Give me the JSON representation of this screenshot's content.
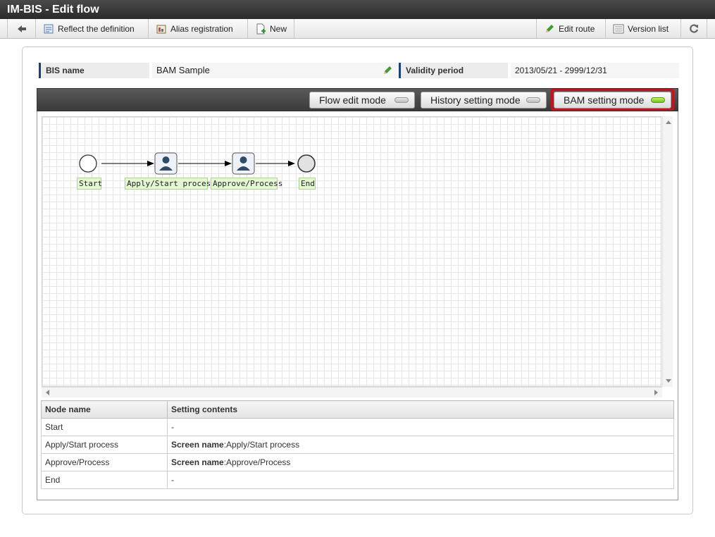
{
  "window": {
    "title": "IM-BIS - Edit flow"
  },
  "toolbar": {
    "back_icon": "back-arrow-icon",
    "reflect_label": "Reflect the definition",
    "alias_label": "Alias registration",
    "new_label": "New",
    "edit_route_label": "Edit route",
    "version_list_label": "Version list",
    "refresh_icon": "refresh-icon"
  },
  "info": {
    "bis_name_label": "BIS name",
    "bis_name_value": "BAM Sample",
    "validity_label": "Validity period",
    "validity_value": "2013/05/21  -  2999/12/31"
  },
  "modes": {
    "flow_edit": {
      "label": "Flow edit mode",
      "active": false
    },
    "history_setting": {
      "label": "History setting mode",
      "active": false
    },
    "bam_setting": {
      "label": "BAM setting mode",
      "active": true
    }
  },
  "flow": {
    "nodes": [
      {
        "label": "Start",
        "type": "start"
      },
      {
        "label": "Apply/Start process",
        "type": "user-task"
      },
      {
        "label": "Approve/Process",
        "type": "user-task"
      },
      {
        "label": "End",
        "type": "end"
      }
    ]
  },
  "settings_table": {
    "headers": [
      "Node name",
      "Setting contents"
    ],
    "rows": [
      {
        "node": "Start",
        "key": "",
        "value": "-"
      },
      {
        "node": "Apply/Start process",
        "key": "Screen name",
        "value": ":Apply/Start process"
      },
      {
        "node": "Approve/Process",
        "key": "Screen name",
        "value": ":Approve/Process"
      },
      {
        "node": "End",
        "key": "",
        "value": "-"
      }
    ]
  },
  "colors": {
    "accent_highlight": "#c8101e",
    "active_led": "#6ec317",
    "label_bg": "#e4f7d2"
  }
}
